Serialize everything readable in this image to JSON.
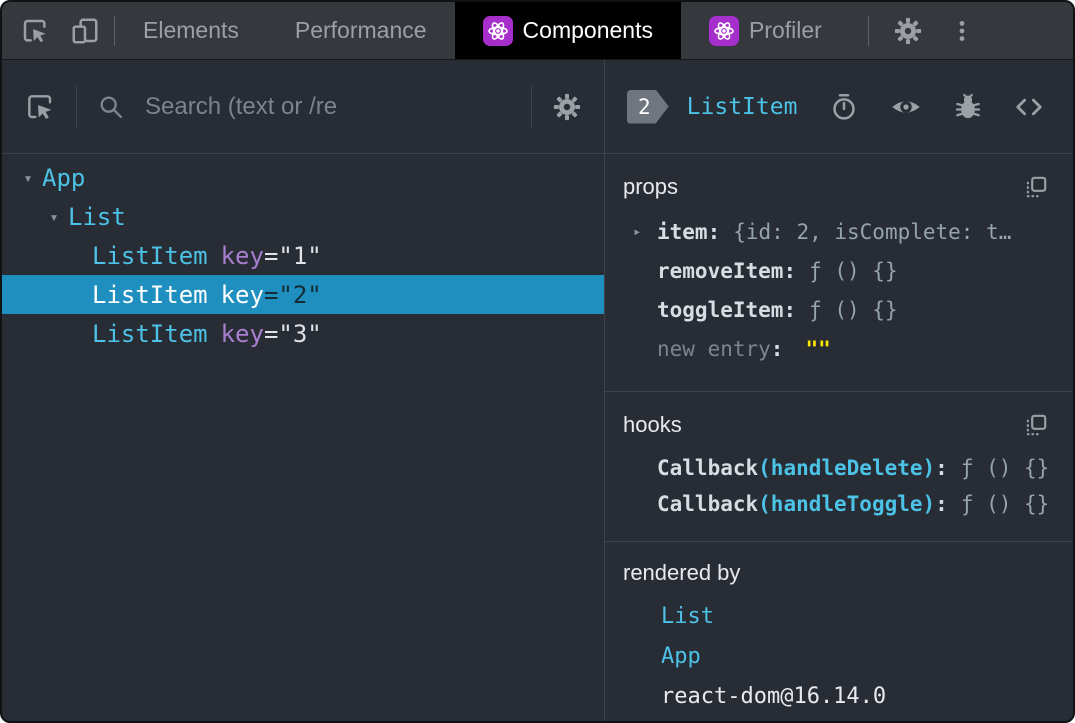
{
  "theme": {
    "bg": "#282c34",
    "topbar": "#35383c",
    "cyan": "#4cc2e6",
    "purple-attr": "#a87fd0",
    "selected-bg": "#1e8fbe",
    "yellow": "#ffe600",
    "react-purple": "#a62ecb",
    "value": "#95a3ae"
  },
  "topbar": {
    "tabs": [
      {
        "label": "Elements"
      },
      {
        "label": "Performance"
      },
      {
        "label": "Components"
      },
      {
        "label": "Profiler"
      }
    ]
  },
  "left_panel": {
    "search": {
      "placeholder": "Search (text or /re"
    },
    "tree": {
      "rows": [
        {
          "expander": "▾",
          "name": "App"
        },
        {
          "expander": "▾",
          "name": "List"
        },
        {
          "name": "ListItem",
          "key_attr": "key",
          "key_value": "=\"1\""
        },
        {
          "name": "ListItem",
          "key_attr": "key",
          "key_value": "=\"2\"",
          "selected": true
        },
        {
          "name": "ListItem",
          "key_attr": "key",
          "key_value": "=\"3\""
        }
      ]
    }
  },
  "right_panel": {
    "header": {
      "badge": "2",
      "title": "ListItem"
    },
    "props": {
      "label": "props",
      "rows": [
        {
          "arrow": "▸",
          "name": "item",
          "sep": ":",
          "value": "{id: 2, isComplete: t…"
        },
        {
          "name": "removeItem",
          "sep": ":",
          "value": "ƒ () {}"
        },
        {
          "name": "toggleItem",
          "sep": ":",
          "value": "ƒ () {}"
        },
        {
          "name": "new entry",
          "sep": ":",
          "value": "\"\""
        }
      ]
    },
    "hooks": {
      "label": "hooks",
      "rows": [
        {
          "name": "Callback",
          "arg": "(handleDelete)",
          "sep": ":",
          "value": "ƒ () {}"
        },
        {
          "name": "Callback",
          "arg": "(handleToggle)",
          "sep": ":",
          "value": "ƒ () {}"
        }
      ]
    },
    "rendered_by": {
      "label": "rendered by",
      "items": [
        {
          "name": "List"
        },
        {
          "name": "App"
        },
        {
          "name": "react-dom@16.14.0"
        }
      ]
    }
  }
}
